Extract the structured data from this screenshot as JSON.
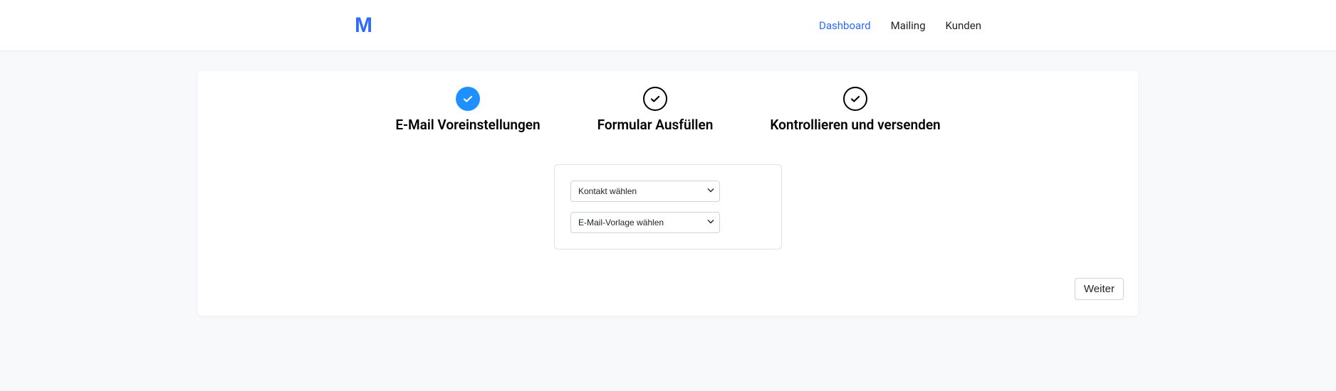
{
  "header": {
    "logo": "M",
    "nav": [
      {
        "label": "Dashboard",
        "active": true
      },
      {
        "label": "Mailing",
        "active": false
      },
      {
        "label": "Kunden",
        "active": false
      }
    ]
  },
  "steps": [
    {
      "label": "E-Mail Voreinstellungen",
      "state": "active"
    },
    {
      "label": "Formular Ausfüllen",
      "state": "inactive"
    },
    {
      "label": "Kontrollieren und versenden",
      "state": "inactive"
    }
  ],
  "form": {
    "selects": [
      {
        "selected": "Kontakt wählen"
      },
      {
        "selected": "E-Mail-Vorlage wählen"
      }
    ]
  },
  "buttons": {
    "next": "Weiter"
  }
}
